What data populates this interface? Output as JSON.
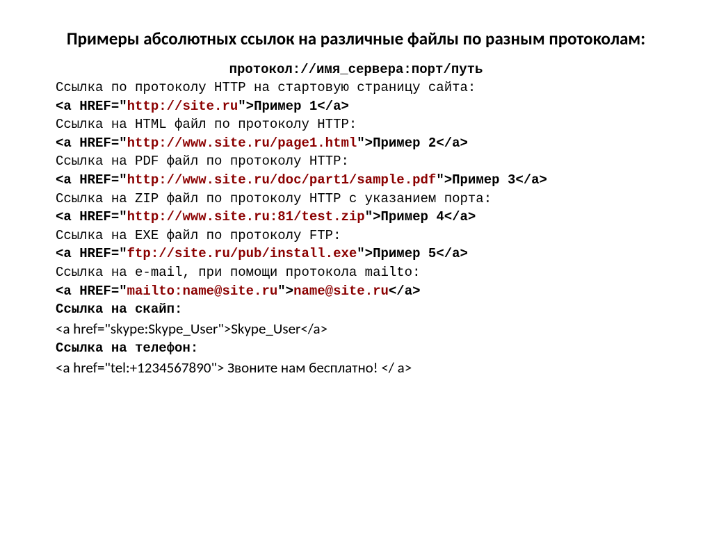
{
  "title": "Примеры абсолютных ссылок на различные файлы по разным протоколам:",
  "format_line": "протокол://имя_сервера:порт/путь",
  "ex1": {
    "desc": "Ссылка по протоколу HTTP на стартовую страницу сайта:",
    "pre": "<a HREF=\"",
    "url": "http://site.ru",
    "mid": "\">",
    "text": "Пример 1",
    "end": "</a>"
  },
  "ex2": {
    "desc": "Ссылка на HTML файл по протоколу HTTP:",
    "pre": "<a HREF=\"",
    "url": "http://www.site.ru/page1.html",
    "mid": "\">",
    "text": "Пример 2",
    "end": "</a>"
  },
  "ex3": {
    "desc": "Ссылка на PDF файл по протоколу HTTP:",
    "pre": "<a HREF=\"",
    "url": "http://www.site.ru/doc/part1/sample.pdf",
    "mid": "\">",
    "text": "Пример 3",
    "end": "</a>"
  },
  "ex4": {
    "desc": "Ссылка на ZIP файл по протоколу HTTP с указанием порта:",
    "pre": "<a HREF=\"",
    "url": "http://www.site.ru:81/test.zip",
    "mid": "\">",
    "text": "Пример 4",
    "end": "</a>"
  },
  "ex5": {
    "desc": "Ссылка на EXE файл по протоколу FTP:",
    "pre": "<a HREF=\"",
    "url": "ftp://site.ru/pub/install.exe",
    "mid": "\">",
    "text": "Пример 5",
    "end": "</a>"
  },
  "ex6": {
    "desc": "Ссылка на e-mail, при помощи протокола mailto:",
    "pre": "<a HREF=\"",
    "url": "mailto:name@site.ru",
    "mid": "\">",
    "text": "name@site.ru",
    "end": "</a>"
  },
  "skype": {
    "heading": "Ссылка на скайп:",
    "code": "<a href=\"skype:Skype_User\">Skype_User</a>"
  },
  "tel": {
    "heading": "Ссылка на телефон:",
    "code": "<a href=\"tel:+1234567890\"> Звоните нам бесплатно! </ a>"
  }
}
